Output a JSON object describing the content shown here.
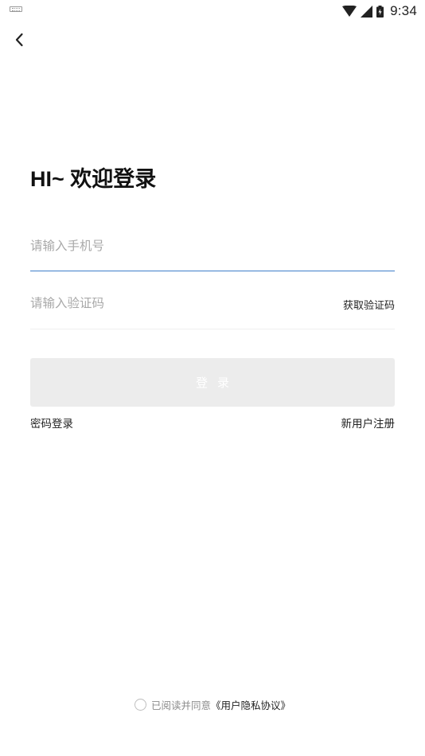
{
  "status_bar": {
    "time": "9:34",
    "icons": [
      "keyboard-icon",
      "wifi-icon",
      "cellular-signal-icon",
      "battery-icon"
    ]
  },
  "nav": {
    "back_icon": "chevron-left-icon"
  },
  "title": "HI~ 欢迎登录",
  "phone": {
    "placeholder": "请输入手机号",
    "value": ""
  },
  "code": {
    "placeholder": "请输入验证码",
    "value": "",
    "get_code_label": "获取验证码"
  },
  "login_button_label": "登录",
  "links": {
    "password_login": "密码登录",
    "register": "新用户注册"
  },
  "agreement": {
    "text": "已阅读并同意",
    "link": "《用户隐私协议》",
    "checked": false
  },
  "colors": {
    "accent": "#3d7ec9",
    "button_disabled_bg": "#ececec",
    "placeholder": "#a9a9a9"
  }
}
